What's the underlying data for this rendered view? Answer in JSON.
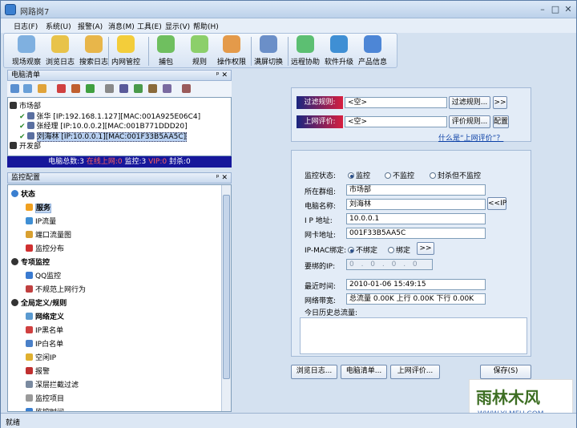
{
  "app": {
    "title": "网路岗7"
  },
  "menu": [
    "日志(F)",
    "系统(U)",
    "报警(A)",
    "消息(M)",
    "工具(E)",
    "显示(V)",
    "帮助(H)"
  ],
  "toolbar": [
    {
      "label": "现场观察",
      "icon": "eye-icon",
      "color": "#7fb0e0"
    },
    {
      "label": "浏览日志",
      "icon": "log-icon",
      "color": "#e8c34a"
    },
    {
      "label": "搜索日志",
      "icon": "search-log-icon",
      "color": "#e8b64a"
    },
    {
      "label": "内网管控",
      "icon": "control-icon",
      "color": "#f3cd3a"
    },
    {
      "label": "捕包",
      "icon": "capture-icon",
      "color": "#6fbf5f"
    },
    {
      "label": "规则",
      "icon": "rule-icon",
      "color": "#8ccf6a"
    },
    {
      "label": "操作权限",
      "icon": "users-icon",
      "color": "#e49a4a"
    },
    {
      "label": "满屏切换",
      "icon": "fullscreen-icon",
      "color": "#6b8fc8"
    },
    {
      "label": "远程协助",
      "icon": "remote-icon",
      "color": "#5cbf72"
    },
    {
      "label": "软件升级",
      "icon": "upgrade-icon",
      "color": "#3f8fd4"
    },
    {
      "label": "产品信息",
      "icon": "help-icon",
      "color": "#4d86d6"
    }
  ],
  "computer_list": {
    "title": "电脑清单",
    "tree": [
      {
        "label": "市场部",
        "level": 0,
        "type": "group"
      },
      {
        "label": "张华 [IP:192.168.1.127][MAC:001A925E06C4]",
        "level": 1,
        "type": "pc"
      },
      {
        "label": "张经理 [IP:10.0.0.2][MAC:001B771DDD20]",
        "level": 1,
        "type": "pc"
      },
      {
        "label": "刘海林 [IP:10.0.0.1][MAC:001F33B5AA5C]",
        "level": 1,
        "type": "pc",
        "selected": true
      },
      {
        "label": "开发部",
        "level": 0,
        "type": "group"
      }
    ],
    "status": {
      "prefix": "电脑总数:3 ",
      "online": "在线上网:0",
      "monitor": " 监控:3 ",
      "vip": "VIP:0",
      "blocked": " 封杀:0"
    }
  },
  "monitor_config": {
    "title": "监控配置",
    "items": [
      {
        "label": "状态",
        "level": 0,
        "bold": true
      },
      {
        "label": "服务",
        "level": 1,
        "bold": true
      },
      {
        "label": "IP流量",
        "level": 1
      },
      {
        "label": "端口流量图",
        "level": 1
      },
      {
        "label": "监控分布",
        "level": 1
      },
      {
        "label": "专项监控",
        "level": 0,
        "bold": true
      },
      {
        "label": "QQ监控",
        "level": 1
      },
      {
        "label": "不规范上网行为",
        "level": 1
      },
      {
        "label": "全局定义/规则",
        "level": 0,
        "bold": true
      },
      {
        "label": "网络定义",
        "level": 1,
        "bold": true
      },
      {
        "label": "IP黑名单",
        "level": 1
      },
      {
        "label": "IP白名单",
        "level": 1
      },
      {
        "label": "空闲IP",
        "level": 1
      },
      {
        "label": "报警",
        "level": 1
      },
      {
        "label": "深层拦截过滤",
        "level": 1
      },
      {
        "label": "监控项目",
        "level": 1
      },
      {
        "label": "监控时间",
        "level": 1
      }
    ]
  },
  "right": {
    "filter_rule": {
      "label": "过滤规则:",
      "value": "<空>",
      "button": "过滤规则...",
      "more": ">>"
    },
    "online_eval": {
      "label": "上网评价:",
      "value": "<空>",
      "button": "评价规则...",
      "config": "配置"
    },
    "what_link": "什么是“上网评价”？",
    "status_label": "监控状态:",
    "status_options": [
      "监控",
      "不监控",
      "封杀但不监控"
    ],
    "group_label": "所在群组:",
    "group_value": "市场部",
    "name_label": "电脑名称:",
    "name_value": "刘海林",
    "name_btn": "<<IP",
    "ip_label": "I P 地址:",
    "ip_value": "10.0.0.1",
    "mac_label": "网卡地址:",
    "mac_value": "001F33B5AA5C",
    "bind_label": "IP-MAC绑定:",
    "bind_options": [
      "不绑定",
      "绑定"
    ],
    "bind_btn": ">>",
    "bindip_label": "要绑的IP:",
    "bindip_value": "0 . 0 . 0 . 0",
    "lasttime_label": "最近时间:",
    "lasttime_value": "2010-01-06 15:49:15",
    "bandwidth_label": "网络带宽:",
    "bandwidth_value": "总流量 0.00K 上行 0.00K 下行 0.00K",
    "history_label": "今日历史总流量:",
    "buttons": [
      "浏览日志...",
      "电脑清单...",
      "上网评价...",
      "保存(S)"
    ]
  },
  "statusbar": {
    "text": "就绪"
  },
  "watermark": {
    "text": "雨林木风",
    "url": "WWW.YLMFU.COM"
  }
}
